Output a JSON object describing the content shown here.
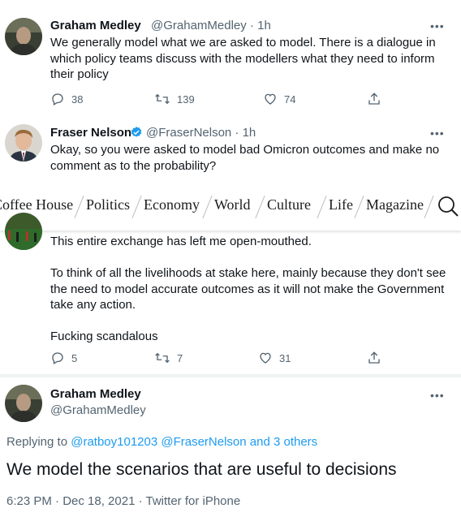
{
  "tweet1": {
    "name": "Graham Medley",
    "handle_time": "@GrahamMedley · 1h",
    "lines": [
      "We generally model what we are asked to model. There is a dialogue in",
      "which policy teams discuss with the modellers what they need to inform",
      "their policy"
    ],
    "replies": "38",
    "retweets": "139",
    "likes": "74"
  },
  "tweet2": {
    "name": "Fraser Nelson",
    "handle_time": "@FraserNelson · 1h",
    "lines": [
      "Okay, so you were asked to model bad Omicron outcomes and make no",
      "comment as to the probability?"
    ]
  },
  "nav": {
    "items": [
      "Coffee House",
      "Politics",
      "Economy",
      "World",
      "Culture",
      "Life",
      "Magazine"
    ]
  },
  "tweet3": {
    "line1": "This entire exchange has left me open-mouthed.",
    "para2": [
      "To think of all the livelihoods at stake here, mainly because they don't see",
      "the need to model accurate outcomes as it will not make the Government",
      "take any action."
    ],
    "para3": "Fucking scandalous",
    "replies": "5",
    "retweets": "7",
    "likes": "31"
  },
  "tweet4": {
    "name": "Graham Medley",
    "handle": "@GrahamMedley",
    "replying_prefix": "Replying to",
    "replying_links": "@ratboy101203 @FraserNelson and 3 others",
    "text": "We model the scenarios that are useful to decisions",
    "meta": "6:23 PM · Dec 18, 2021 · Twitter for iPhone"
  },
  "more_glyph": "•••",
  "colors": {
    "verified": "#1d9bf0",
    "link": "#1d9bf0",
    "secondary": "#536471"
  }
}
